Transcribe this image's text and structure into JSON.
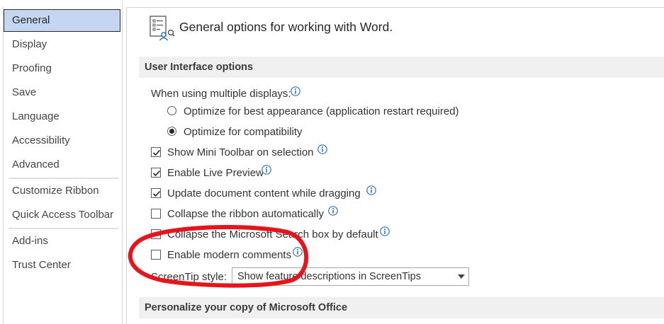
{
  "sidebar": {
    "items": [
      {
        "label": "General"
      },
      {
        "label": "Display"
      },
      {
        "label": "Proofing"
      },
      {
        "label": "Save"
      },
      {
        "label": "Language"
      },
      {
        "label": "Accessibility"
      },
      {
        "label": "Advanced"
      },
      {
        "label": "Customize Ribbon"
      },
      {
        "label": "Quick Access Toolbar"
      },
      {
        "label": "Add-ins"
      },
      {
        "label": "Trust Center"
      }
    ],
    "selected": "General"
  },
  "header": {
    "title": "General options for working with Word.",
    "icon": "general-options-icon"
  },
  "sections": {
    "ui_options": {
      "title": "User Interface options",
      "multiple_displays_label": "When using multiple displays:",
      "radio_best_appearance": "Optimize for best appearance (application restart required)",
      "radio_compatibility": "Optimize for compatibility",
      "selected_radio": "Optimize for compatibility",
      "chk_mini_toolbar": "Show Mini Toolbar on selection",
      "chk_live_preview": "Enable Live Preview",
      "chk_update_dragging": "Update document content while dragging",
      "chk_collapse_ribbon": "Collapse the ribbon automatically",
      "chk_collapse_search": "Collapse the Microsoft Search box by default",
      "chk_modern_comments": "Enable modern comments",
      "screentip_label": "ScreenTip style:",
      "screentip_value": "Show feature descriptions in ScreenTips"
    },
    "personalize": {
      "title": "Personalize your copy of Microsoft Office"
    }
  },
  "checkbox_states": {
    "mini_toolbar": true,
    "live_preview": true,
    "update_dragging": true,
    "collapse_ribbon": false,
    "collapse_search": false,
    "modern_comments": false
  },
  "colors": {
    "selected_bg": "#c5d6f2",
    "info_icon": "#2e75b6",
    "annotation": "#e8141b"
  }
}
